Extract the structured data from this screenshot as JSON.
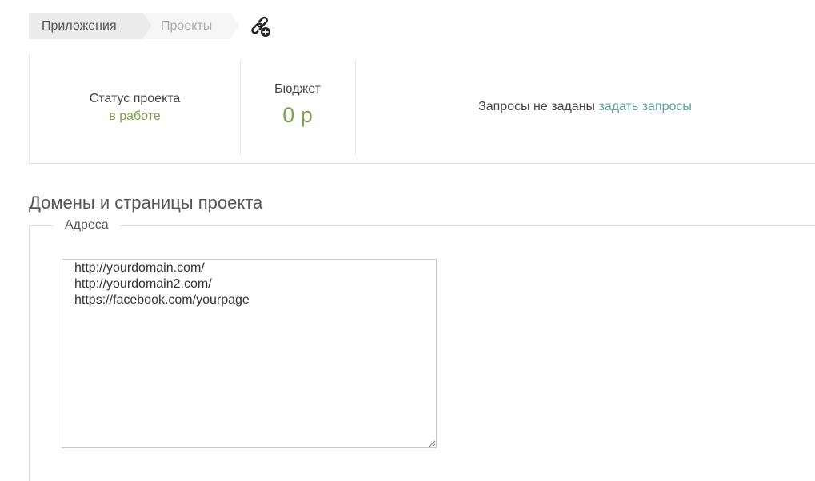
{
  "breadcrumb": {
    "items": [
      {
        "label": "Приложения"
      },
      {
        "label": "Проекты"
      }
    ]
  },
  "icons": {
    "link_add": "link-add-icon"
  },
  "stats": {
    "status_label": "Статус проекта",
    "status_value": "в работе",
    "budget_label": "Бюджет",
    "budget_value": "0 р",
    "queries_text": "Запросы не заданы",
    "queries_link": "задать запросы"
  },
  "colors": {
    "accent_green": "#7aa34a",
    "link_teal": "#5da3a3"
  },
  "section": {
    "title": "Домены и страницы проекта",
    "legend": "Адреса",
    "addresses_value": "http://yourdomain.com/\nhttp://yourdomain2.com/\nhttps://facebook.com/yourpage"
  }
}
